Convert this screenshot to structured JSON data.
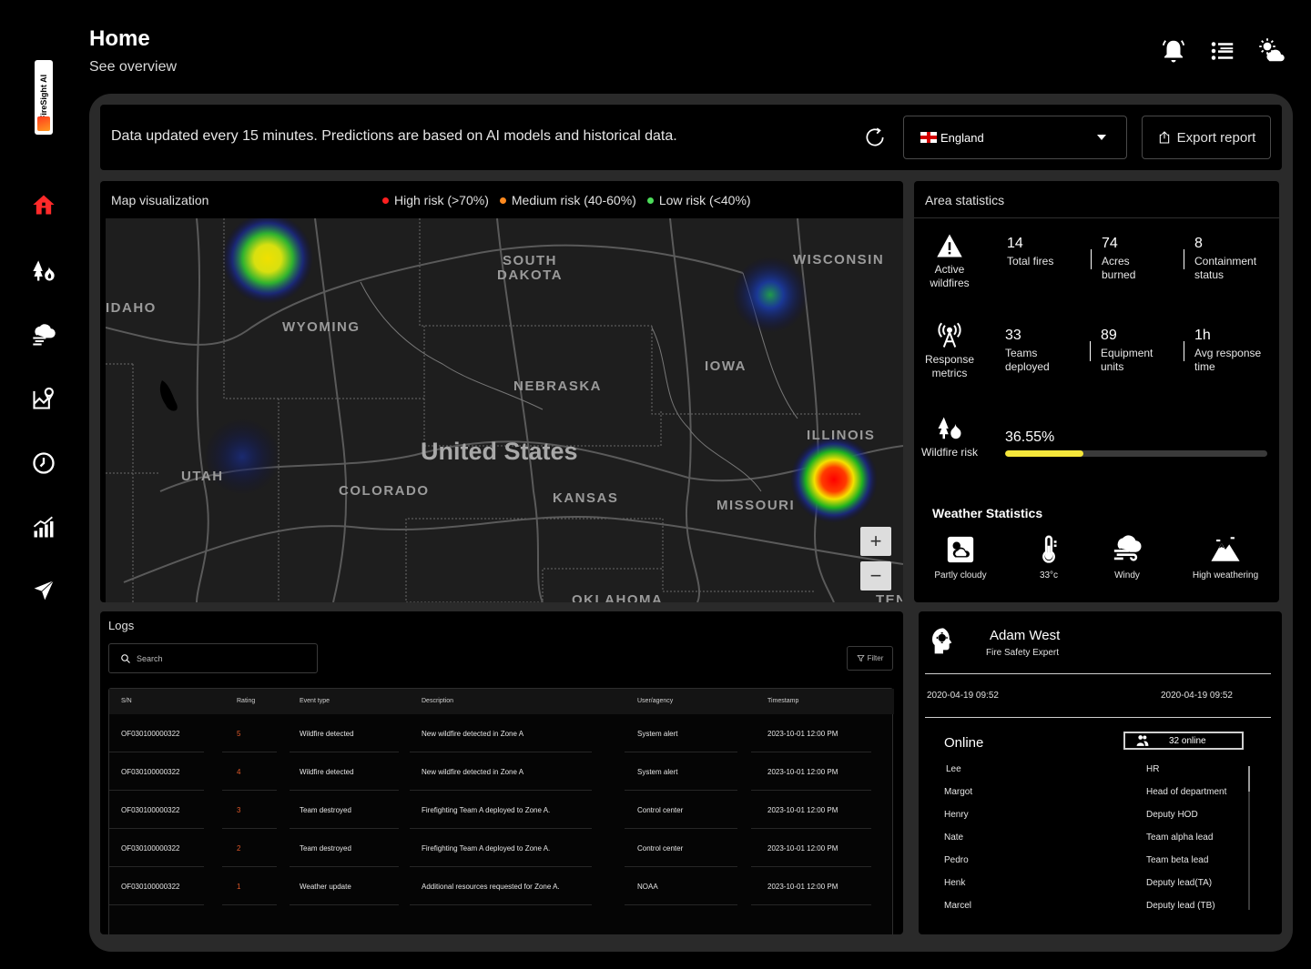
{
  "app": {
    "logo_text": "FireSight AI"
  },
  "header": {
    "title": "Home",
    "subtitle": "See overview"
  },
  "nav": {
    "items": [
      {
        "name": "home",
        "icon": "home-icon",
        "active": true
      },
      {
        "name": "wildfires",
        "icon": "fire-icon"
      },
      {
        "name": "weather",
        "icon": "wind-cloud-icon"
      },
      {
        "name": "map",
        "icon": "map-pin-icon"
      },
      {
        "name": "history",
        "icon": "clock-icon"
      },
      {
        "name": "analytics",
        "icon": "bar-chart-icon"
      },
      {
        "name": "send",
        "icon": "send-icon"
      }
    ]
  },
  "topbar": {
    "notice": "Data updated every 15 minutes. Predictions are based on AI models and historical data.",
    "country": "England",
    "export_label": "Export report"
  },
  "map": {
    "title": "Map visualization",
    "legend": [
      {
        "label": "High risk (>70%)",
        "color": "#ff2020"
      },
      {
        "label": "Medium risk (40-60%)",
        "color": "#ff8a1f"
      },
      {
        "label": "Low risk (<40%)",
        "color": "#4cdc5a"
      }
    ],
    "country_label": "United States",
    "labels": {
      "south_dakota_1": "SOUTH",
      "south_dakota_2": "DAKOTA",
      "wisconsin": "WISCONSIN",
      "idaho": "IDAHO",
      "wyoming": "WYOMING",
      "nebraska": "NEBRASKA",
      "iowa": "IOWA",
      "illinois": "ILLINOIS",
      "utah": "UTAH",
      "colorado": "COLORADO",
      "kansas": "KANSAS",
      "missouri": "MISSOURI",
      "oklahoma": "OKLAHOMA",
      "ten": "TEN"
    },
    "zoom_in": "+",
    "zoom_out": "−"
  },
  "stats": {
    "title": "Area statistics",
    "active": {
      "label": "Active wildfires",
      "metrics": [
        {
          "value": "14",
          "label": "Total fires"
        },
        {
          "value": "74",
          "label": "Acres burned"
        },
        {
          "value": "8",
          "label": "Containment status"
        }
      ]
    },
    "response": {
      "label": "Response metrics",
      "metrics": [
        {
          "value": "33",
          "label": "Teams deployed"
        },
        {
          "value": "89",
          "label": "Equipment units"
        },
        {
          "value": "1h",
          "label": "Avg response time"
        }
      ]
    },
    "risk": {
      "label": "Wildfire risk",
      "value": "36.55%",
      "fraction": 0.3
    },
    "weather_title": "Weather Statistics",
    "weather": [
      {
        "label": "Partly cloudy",
        "icon": "partly-cloudy-icon"
      },
      {
        "label": "33°c",
        "icon": "thermometer-icon"
      },
      {
        "label": "Windy",
        "icon": "windy-icon"
      },
      {
        "label": "High weathering",
        "icon": "mountain-icon"
      }
    ]
  },
  "logs": {
    "title": "Logs",
    "search_placeholder": "Search",
    "filter_label": "Filter",
    "columns": [
      "S/N",
      "Rating",
      "Event type",
      "Description",
      "User/agency",
      "Timestamp"
    ],
    "rows": [
      {
        "sn": "OF030100000322",
        "rating": "5",
        "event": "Wildfire detected",
        "desc": "New wildfire detected in Zone A",
        "user": "System alert",
        "time": "2023-10-01 12:00 PM"
      },
      {
        "sn": "OF030100000322",
        "rating": "4",
        "event": "Wildfire detected",
        "desc": "New wildfire detected in Zone A",
        "user": "System alert",
        "time": "2023-10-01 12:00 PM"
      },
      {
        "sn": "OF030100000322",
        "rating": "3",
        "event": "Team destroyed",
        "desc": "Firefighting Team A deployed to Zone A.",
        "user": "Control center",
        "time": "2023-10-01 12:00 PM"
      },
      {
        "sn": "OF030100000322",
        "rating": "2",
        "event": "Team destroyed",
        "desc": "Firefighting Team A deployed to Zone A.",
        "user": "Control center",
        "time": "2023-10-01 12:00 PM"
      },
      {
        "sn": "OF030100000322",
        "rating": "1",
        "event": "Weather update",
        "desc": "Additional resources requested for Zone A.",
        "user": "NOAA",
        "time": "2023-10-01 12:00 PM"
      }
    ]
  },
  "profile": {
    "name": "Adam West",
    "role": "Fire Safety Expert",
    "date_left": "2020-04-19 09:52",
    "date_right": "2020-04-19 09:52",
    "online_title": "Online",
    "online_count": "32 online",
    "people": [
      {
        "name": "Lee",
        "role": "HR"
      },
      {
        "name": "Margot",
        "role": "Head of department"
      },
      {
        "name": "Henry",
        "role": "Deputy HOD"
      },
      {
        "name": "Nate",
        "role": "Team alpha lead"
      },
      {
        "name": "Pedro",
        "role": "Team beta lead"
      },
      {
        "name": "Henk",
        "role": "Deputy lead(TA)"
      },
      {
        "name": "Marcel",
        "role": "Deputy lead (TB)"
      }
    ]
  }
}
